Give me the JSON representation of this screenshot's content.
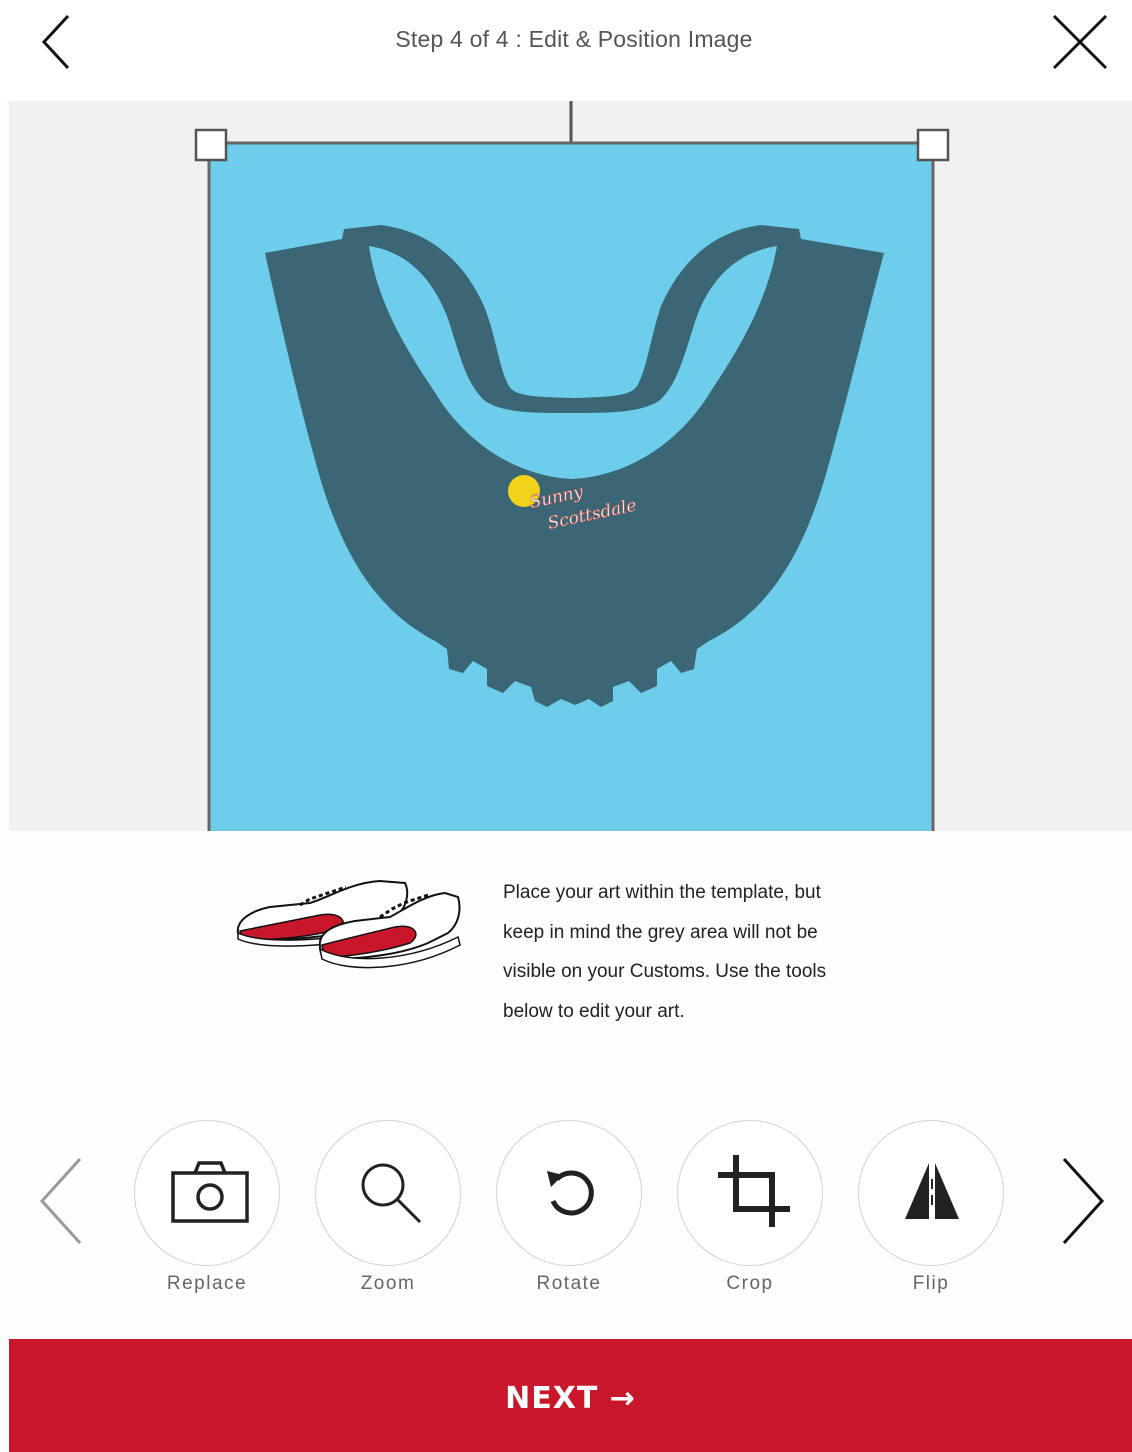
{
  "header": {
    "title": "Step 4 of 4 : Edit & Position Image",
    "back_icon": "chevron-left-icon",
    "close_icon": "close-icon"
  },
  "canvas": {
    "background_color": "#f1f1f1",
    "template_color": "#6dcdeb",
    "product_color": "#3a6675",
    "art_text_line1": "Sunny",
    "art_text_line2": "Scottsdale"
  },
  "info": {
    "image": "sneakers-illustration",
    "text": "Place your art within the template, but keep in mind the grey area will not be visible on your Customs. Use the tools below to edit your art.",
    "lines": [
      "Place your art within the template, but",
      "keep in mind the grey area will not be",
      "visible on your Customs. Use the tools",
      "below to edit your art."
    ]
  },
  "tools": {
    "prev_icon": "chevron-left-icon",
    "next_icon": "chevron-right-icon",
    "items": [
      {
        "label": "Replace",
        "icon": "camera-icon"
      },
      {
        "label": "Zoom",
        "icon": "magnifier-icon"
      },
      {
        "label": "Rotate",
        "icon": "rotate-icon"
      },
      {
        "label": "Crop",
        "icon": "crop-icon"
      },
      {
        "label": "Flip",
        "icon": "flip-icon"
      }
    ]
  },
  "footer": {
    "next_label": "NEXT →",
    "accent_color": "#c8172a"
  }
}
